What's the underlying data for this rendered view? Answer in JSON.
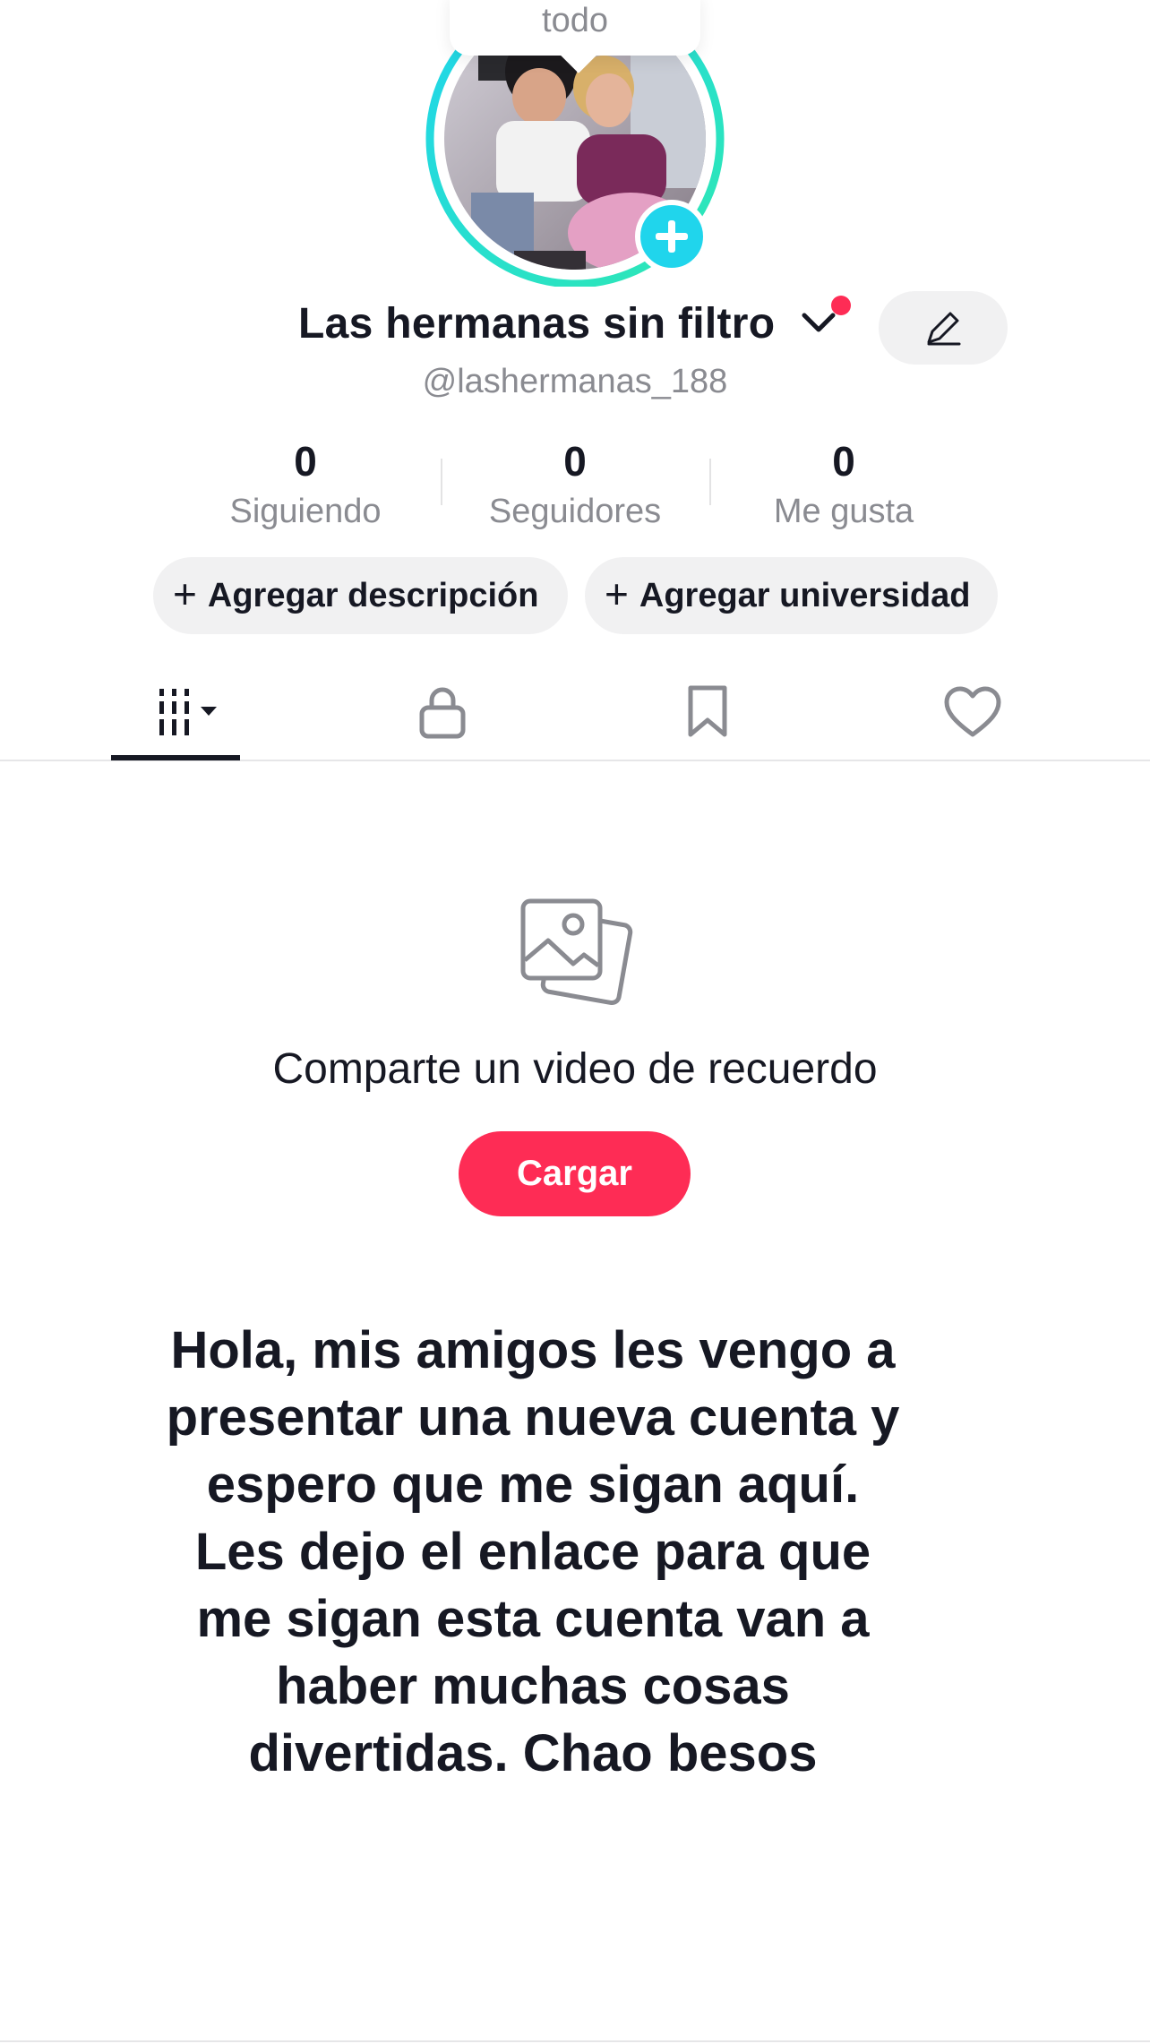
{
  "tooltip": {
    "text": "todo"
  },
  "profile": {
    "display_name": "Las hermanas sin filtro",
    "username": "@lashermanas_188",
    "avatar_icon": "profile-photo",
    "ring_colors": [
      "#20d5ec",
      "#2ee8b2"
    ],
    "notification_color": "#fe2c55"
  },
  "stats": [
    {
      "value": "0",
      "label": "Siguiendo"
    },
    {
      "value": "0",
      "label": "Seguidores"
    },
    {
      "value": "0",
      "label": "Me gusta"
    }
  ],
  "chips": {
    "description": "Agregar descripción",
    "university": "Agregar universidad"
  },
  "tabs": [
    {
      "icon": "videos-grid-icon",
      "active": true
    },
    {
      "icon": "lock-icon",
      "active": false
    },
    {
      "icon": "bookmark-icon",
      "active": false
    },
    {
      "icon": "heart-icon",
      "active": false
    }
  ],
  "empty_state": {
    "icon": "photos-icon",
    "title": "Comparte un video de recuerdo",
    "button_label": "Cargar",
    "button_color": "#fe2c55"
  },
  "message": {
    "lines": [
      "Hola, mis amigos les vengo a",
      "presentar una nueva cuenta y",
      "espero que me sigan aquí.",
      "Les dejo el enlace para que",
      "me sigan esta cuenta van a",
      "haber muchas cosas",
      "divertidas. Chao besos"
    ]
  }
}
